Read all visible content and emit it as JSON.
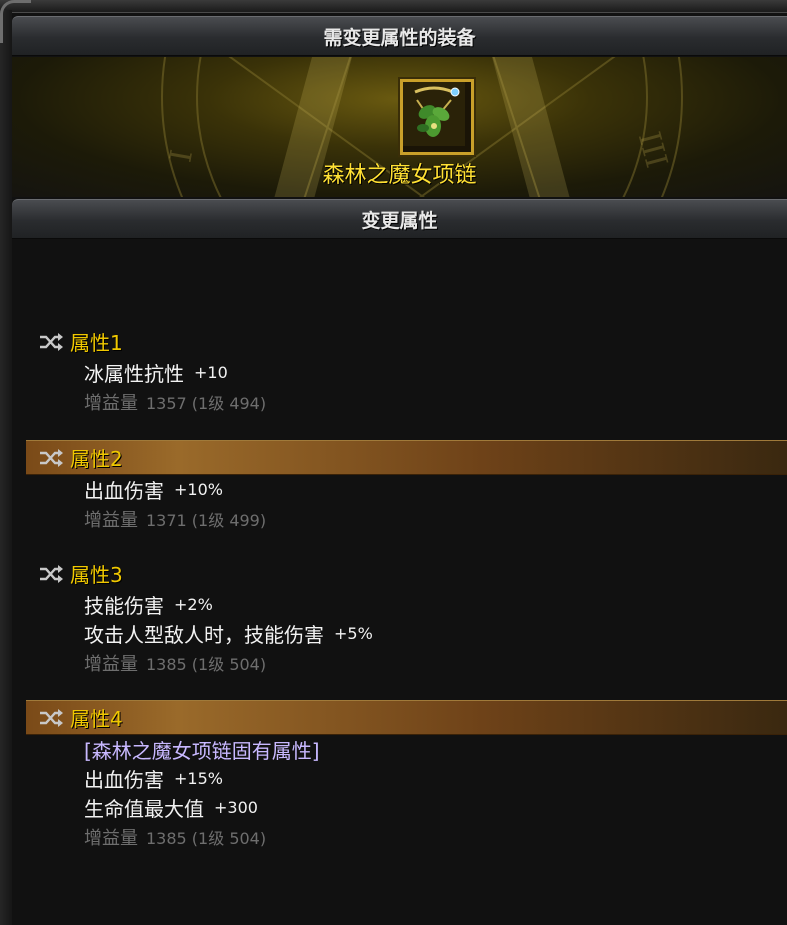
{
  "panel": {
    "equip_header": "需变更属性的装备",
    "change_header": "变更属性"
  },
  "item": {
    "name": "森林之魔女项链",
    "frame_color": "#c9a02a",
    "name_color": "#ffe033"
  },
  "attributes": [
    {
      "label": "属性1",
      "highlighted": false,
      "tag": "",
      "lines": [
        {
          "name": "冰属性抗性",
          "value": "+10"
        }
      ],
      "gain_label": "增益量",
      "gain_value": "1357 (1级 494)"
    },
    {
      "label": "属性2",
      "highlighted": true,
      "tag": "",
      "lines": [
        {
          "name": "出血伤害",
          "value": "+10%"
        }
      ],
      "gain_label": "增益量",
      "gain_value": "1371 (1级 499)"
    },
    {
      "label": "属性3",
      "highlighted": false,
      "tag": "",
      "lines": [
        {
          "name": "技能伤害",
          "value": "+2%"
        },
        {
          "name": "攻击人型敌人时，技能伤害",
          "value": "+5%"
        }
      ],
      "gain_label": "增益量",
      "gain_value": "1385 (1级 504)"
    },
    {
      "label": "属性4",
      "highlighted": true,
      "tag": "[森林之魔女项链固有属性]",
      "lines": [
        {
          "name": "出血伤害",
          "value": "+15%"
        },
        {
          "name": "生命值最大值",
          "value": "+300"
        }
      ],
      "gain_label": "增益量",
      "gain_value": "1385 (1级 504)"
    }
  ],
  "colors": {
    "attr_label": "#f0c800",
    "gain_text": "#6e6e6e",
    "highlight_bar": "#7a4a18"
  },
  "icons": {
    "attr_icon": "shuffle-icon",
    "item_icon": "necklace-icon"
  }
}
